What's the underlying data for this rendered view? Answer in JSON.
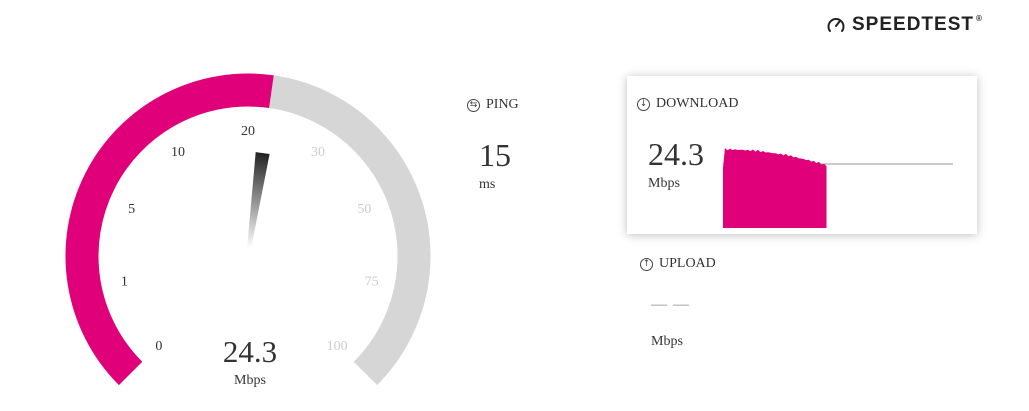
{
  "brand": {
    "icon": "gauge-icon",
    "name": "SPEEDTEST",
    "mark": "®"
  },
  "colors": {
    "accent": "#e0007a",
    "track": "#d6d6d6",
    "text": "#333333",
    "muted": "#cccccc"
  },
  "gauge": {
    "scale_labels": [
      "0",
      "1",
      "5",
      "10",
      "20",
      "30",
      "50",
      "75",
      "100"
    ],
    "active_label_count": 5,
    "value": "24.3",
    "unit": "Mbps",
    "fill_fraction": 0.53
  },
  "ping": {
    "icon": "ping-icon",
    "label": "PING",
    "value": "15",
    "unit": "ms"
  },
  "download": {
    "icon": "download-arrow-icon",
    "label": "DOWNLOAD",
    "value": "24.3",
    "unit": "Mbps",
    "progress": 0.45
  },
  "upload": {
    "icon": "upload-arrow-icon",
    "label": "UPLOAD",
    "value": "— —",
    "unit": "Mbps"
  }
}
